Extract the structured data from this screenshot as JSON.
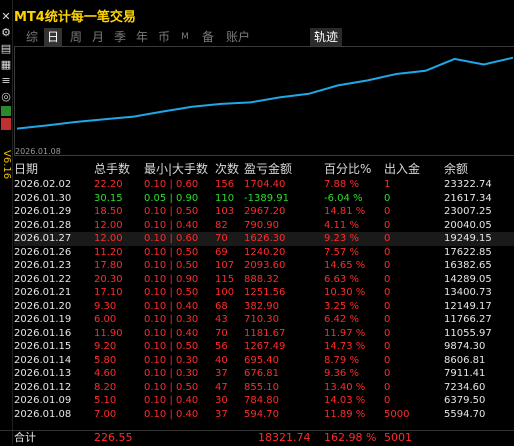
{
  "title": "MT4统计每一笔交易",
  "version": "V6.16",
  "tabs": [
    {
      "label": "综",
      "active": false
    },
    {
      "label": "日",
      "active": true
    },
    {
      "label": "周",
      "active": false
    },
    {
      "label": "月",
      "active": false
    },
    {
      "label": "季",
      "active": false
    },
    {
      "label": "年",
      "active": false
    },
    {
      "label": "币",
      "active": false
    },
    {
      "label": "M",
      "active": false
    },
    {
      "label": "备",
      "active": false
    },
    {
      "label": "账户",
      "active": false
    }
  ],
  "track_tab": "轨迹",
  "chart": {
    "x_label": "2026.01.08",
    "line_color": "#1fa8e8",
    "series_values": [
      5594.7,
      6379.5,
      7234.6,
      7911.41,
      8606.81,
      9874.3,
      11055.97,
      11766.27,
      12149.17,
      13400.73,
      14289.05,
      16382.65,
      17622.85,
      19249.15,
      20040.05,
      23007.25,
      21617.34,
      23322.74
    ]
  },
  "table": {
    "headers": [
      "日期",
      "总手数",
      "最小|大手数",
      "次数",
      "盈亏金额",
      "百分比%",
      "出入金",
      "余额"
    ],
    "rows": [
      {
        "date": "2026.02.02",
        "lots": "22.20",
        "minmax": "0.10 | 0.60",
        "count": "156",
        "pnl": "1704.40",
        "pct": "7.88 %",
        "flow": "1",
        "balance": "23322.74",
        "tone": "red"
      },
      {
        "date": "2026.01.30",
        "lots": "30.15",
        "minmax": "0.05 | 0.90",
        "count": "110",
        "pnl": "-1389.91",
        "pct": "-6.04 %",
        "flow": "0",
        "balance": "21617.34",
        "tone": "green"
      },
      {
        "date": "2026.01.29",
        "lots": "18.50",
        "minmax": "0.10 | 0.50",
        "count": "103",
        "pnl": "2967.20",
        "pct": "14.81 %",
        "flow": "0",
        "balance": "23007.25",
        "tone": "red"
      },
      {
        "date": "2026.01.28",
        "lots": "12.00",
        "minmax": "0.10 | 0.40",
        "count": "82",
        "pnl": "790.90",
        "pct": "4.11 %",
        "flow": "0",
        "balance": "20040.05",
        "tone": "red"
      },
      {
        "date": "2026.01.27",
        "lots": "12.00",
        "minmax": "0.10 | 0.60",
        "count": "70",
        "pnl": "1626.30",
        "pct": "9.23 %",
        "flow": "0",
        "balance": "19249.15",
        "tone": "red"
      },
      {
        "date": "2026.01.26",
        "lots": "11.20",
        "minmax": "0.10 | 0.50",
        "count": "69",
        "pnl": "1240.20",
        "pct": "7.57 %",
        "flow": "0",
        "balance": "17622.85",
        "tone": "red"
      },
      {
        "date": "2026.01.23",
        "lots": "17.80",
        "minmax": "0.10 | 0.50",
        "count": "107",
        "pnl": "2093.60",
        "pct": "14.65 %",
        "flow": "0",
        "balance": "16382.65",
        "tone": "red"
      },
      {
        "date": "2026.01.22",
        "lots": "20.30",
        "minmax": "0.10 | 0.90",
        "count": "115",
        "pnl": "888.32",
        "pct": "6.63 %",
        "flow": "0",
        "balance": "14289.05",
        "tone": "red"
      },
      {
        "date": "2026.01.21",
        "lots": "17.10",
        "minmax": "0.10 | 0.50",
        "count": "100",
        "pnl": "1251.56",
        "pct": "10.30 %",
        "flow": "0",
        "balance": "13400.73",
        "tone": "red"
      },
      {
        "date": "2026.01.20",
        "lots": "9.30",
        "minmax": "0.10 | 0.40",
        "count": "68",
        "pnl": "382.90",
        "pct": "3.25 %",
        "flow": "0",
        "balance": "12149.17",
        "tone": "red"
      },
      {
        "date": "2026.01.19",
        "lots": "6.00",
        "minmax": "0.10 | 0.30",
        "count": "43",
        "pnl": "710.30",
        "pct": "6.42 %",
        "flow": "0",
        "balance": "11766.27",
        "tone": "red"
      },
      {
        "date": "2026.01.16",
        "lots": "11.90",
        "minmax": "0.10 | 0.40",
        "count": "70",
        "pnl": "1181.67",
        "pct": "11.97 %",
        "flow": "0",
        "balance": "11055.97",
        "tone": "red"
      },
      {
        "date": "2026.01.15",
        "lots": "9.20",
        "minmax": "0.10 | 0.50",
        "count": "56",
        "pnl": "1267.49",
        "pct": "14.73 %",
        "flow": "0",
        "balance": "9874.30",
        "tone": "red"
      },
      {
        "date": "2026.01.14",
        "lots": "5.80",
        "minmax": "0.10 | 0.30",
        "count": "40",
        "pnl": "695.40",
        "pct": "8.79 %",
        "flow": "0",
        "balance": "8606.81",
        "tone": "red"
      },
      {
        "date": "2026.01.13",
        "lots": "4.60",
        "minmax": "0.10 | 0.30",
        "count": "37",
        "pnl": "676.81",
        "pct": "9.36 %",
        "flow": "0",
        "balance": "7911.41",
        "tone": "red"
      },
      {
        "date": "2026.01.12",
        "lots": "8.20",
        "minmax": "0.10 | 0.50",
        "count": "47",
        "pnl": "855.10",
        "pct": "13.40 %",
        "flow": "0",
        "balance": "7234.60",
        "tone": "red"
      },
      {
        "date": "2026.01.09",
        "lots": "5.10",
        "minmax": "0.10 | 0.40",
        "count": "30",
        "pnl": "784.80",
        "pct": "14.03 %",
        "flow": "0",
        "balance": "6379.50",
        "tone": "red"
      },
      {
        "date": "2026.01.08",
        "lots": "7.00",
        "minmax": "0.10 | 0.40",
        "count": "37",
        "pnl": "594.70",
        "pct": "11.89 %",
        "flow": "5000",
        "balance": "5594.70",
        "tone": "red"
      }
    ],
    "footer": {
      "label": "合计",
      "lots": "226.55",
      "pnl": "18321.74",
      "pct": "162.98 %",
      "flow": "5001"
    }
  },
  "colors": {
    "profit": "#ff2b2b",
    "loss": "#2bdc2b",
    "title": "#ffd400",
    "background": "#000000"
  },
  "icons": [
    "close-icon",
    "chart-icon",
    "calendar-icon",
    "compass-icon"
  ]
}
